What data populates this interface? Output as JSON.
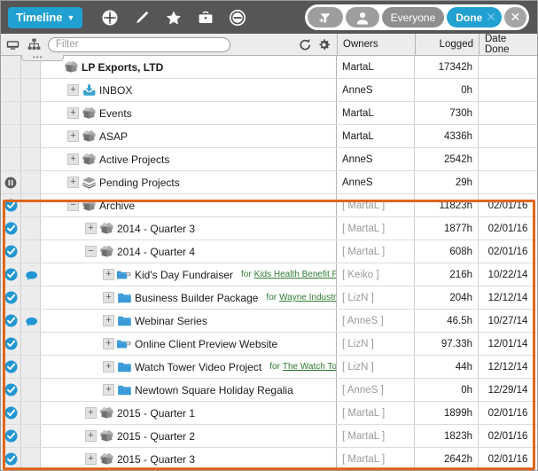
{
  "toolbar": {
    "timeline_label": "Timeline",
    "caret": "▼",
    "icons": [
      {
        "name": "add-icon",
        "label": "Add"
      },
      {
        "name": "edit-pencil-icon",
        "label": "Edit"
      },
      {
        "name": "star-icon",
        "label": "Favorite"
      },
      {
        "name": "briefcase-icon",
        "label": "Briefcase"
      },
      {
        "name": "minus-circle-icon",
        "label": "Remove"
      }
    ],
    "pills": {
      "filter_icon": "filter-add-icon",
      "person_icon": "person-icon",
      "everyone_label": "Everyone",
      "done_label": "Done",
      "done_close": "✕",
      "close_label": "✕"
    }
  },
  "filterbar": {
    "view_icon": "monitor-icon",
    "hierarchy_icon": "org-tree-icon",
    "placeholder": "Filter",
    "value": "",
    "refresh_icon": "refresh-icon",
    "settings_icon": "gear-icon",
    "columns": {
      "owners": "Owners",
      "logged": "Logged",
      "date_done": "Date Done"
    }
  },
  "tree": {
    "rows": [
      {
        "indent": 0,
        "twisty": "",
        "icon": "box-icon",
        "label": "LP Exports, LTD",
        "bold": true,
        "owner": "MartaL",
        "logged": "17342h",
        "date": "",
        "check": false,
        "comment": false,
        "dim": false,
        "pause": false,
        "for_label": "",
        "for_link": ""
      },
      {
        "indent": 1,
        "twisty": "+",
        "icon": "inbox-icon",
        "label": "INBOX",
        "bold": false,
        "owner": "AnneS",
        "logged": "0h",
        "date": "",
        "check": false,
        "comment": false,
        "dim": false,
        "pause": false,
        "for_label": "",
        "for_link": ""
      },
      {
        "indent": 1,
        "twisty": "+",
        "icon": "box-icon",
        "label": "Events",
        "bold": false,
        "owner": "MartaL",
        "logged": "730h",
        "date": "",
        "check": false,
        "comment": false,
        "dim": false,
        "pause": false,
        "for_label": "",
        "for_link": ""
      },
      {
        "indent": 1,
        "twisty": "+",
        "icon": "box-icon",
        "label": "ASAP",
        "bold": false,
        "owner": "MartaL",
        "logged": "4336h",
        "date": "",
        "check": false,
        "comment": false,
        "dim": false,
        "pause": false,
        "for_label": "",
        "for_link": ""
      },
      {
        "indent": 1,
        "twisty": "+",
        "icon": "box-icon",
        "label": "Active Projects",
        "bold": false,
        "owner": "AnneS",
        "logged": "2542h",
        "date": "",
        "check": false,
        "comment": false,
        "dim": false,
        "pause": false,
        "for_label": "",
        "for_link": ""
      },
      {
        "indent": 1,
        "twisty": "+",
        "icon": "stack-icon",
        "label": "Pending Projects",
        "bold": false,
        "owner": "AnneS",
        "logged": "29h",
        "date": "",
        "check": false,
        "comment": false,
        "dim": false,
        "pause": true,
        "for_label": "",
        "for_link": ""
      },
      {
        "indent": 1,
        "twisty": "−",
        "icon": "box-icon",
        "label": "Archive",
        "bold": false,
        "owner": "[ MartaL ]",
        "logged": "11823h",
        "date": "02/01/16",
        "check": true,
        "comment": false,
        "dim": true,
        "pause": false,
        "for_label": "",
        "for_link": ""
      },
      {
        "indent": 2,
        "twisty": "+",
        "icon": "box-icon",
        "label": "2014 - Quarter 3",
        "bold": false,
        "owner": "[ MartaL ]",
        "logged": "1877h",
        "date": "02/01/16",
        "check": true,
        "comment": false,
        "dim": true,
        "pause": false,
        "for_label": "",
        "for_link": ""
      },
      {
        "indent": 2,
        "twisty": "−",
        "icon": "box-icon",
        "label": "2014 - Quarter 4",
        "bold": false,
        "owner": "[ MartaL ]",
        "logged": "608h",
        "date": "02/01/16",
        "check": true,
        "comment": false,
        "dim": true,
        "pause": false,
        "for_label": "",
        "for_link": ""
      },
      {
        "indent": 3,
        "twisty": "+",
        "icon": "folder-arrow-icon",
        "label": "Kid's Day Fundraiser",
        "bold": false,
        "owner": "[ Keiko ]",
        "logged": "216h",
        "date": "10/22/14",
        "check": true,
        "comment": true,
        "dim": true,
        "pause": false,
        "for_label": "for",
        "for_link": "Kids Health Benefit Fund"
      },
      {
        "indent": 3,
        "twisty": "+",
        "icon": "folder-icon",
        "label": "Business Builder Package",
        "bold": false,
        "owner": "[ LizN ]",
        "logged": "204h",
        "date": "12/12/14",
        "check": true,
        "comment": false,
        "dim": true,
        "pause": false,
        "for_label": "for",
        "for_link": "Wayne Industries"
      },
      {
        "indent": 3,
        "twisty": "+",
        "icon": "folder-icon",
        "label": "Webinar Series",
        "bold": false,
        "owner": "[ AnneS ]",
        "logged": "46.5h",
        "date": "10/27/14",
        "check": true,
        "comment": true,
        "dim": true,
        "pause": false,
        "for_label": "",
        "for_link": ""
      },
      {
        "indent": 3,
        "twisty": "+",
        "icon": "folder-arrow-icon",
        "label": "Online Client Preview Website",
        "bold": false,
        "owner": "[ LizN ]",
        "logged": "97.33h",
        "date": "12/01/14",
        "check": true,
        "comment": false,
        "dim": true,
        "pause": false,
        "for_label": "",
        "for_link": ""
      },
      {
        "indent": 3,
        "twisty": "+",
        "icon": "folder-icon",
        "label": "Watch Tower Video Project",
        "bold": false,
        "owner": "[ LizN ]",
        "logged": "44h",
        "date": "12/12/14",
        "check": true,
        "comment": false,
        "dim": true,
        "pause": false,
        "for_label": "for",
        "for_link": "The Watch Tower"
      },
      {
        "indent": 3,
        "twisty": "+",
        "icon": "folder-icon",
        "label": "Newtown Square Holiday Regalia",
        "bold": false,
        "owner": "[ AnneS ]",
        "logged": "0h",
        "date": "12/29/14",
        "check": true,
        "comment": false,
        "dim": true,
        "pause": false,
        "for_label": "",
        "for_link": ""
      },
      {
        "indent": 2,
        "twisty": "+",
        "icon": "box-icon",
        "label": "2015 - Quarter 1",
        "bold": false,
        "owner": "[ MartaL ]",
        "logged": "1899h",
        "date": "02/01/16",
        "check": true,
        "comment": false,
        "dim": true,
        "pause": false,
        "for_label": "",
        "for_link": ""
      },
      {
        "indent": 2,
        "twisty": "+",
        "icon": "box-icon",
        "label": "2015 - Quarter 2",
        "bold": false,
        "owner": "[ MartaL ]",
        "logged": "1823h",
        "date": "02/01/16",
        "check": true,
        "comment": false,
        "dim": true,
        "pause": false,
        "for_label": "",
        "for_link": ""
      },
      {
        "indent": 2,
        "twisty": "+",
        "icon": "box-icon",
        "label": "2015 - Quarter 3",
        "bold": false,
        "owner": "[ MartaL ]",
        "logged": "2642h",
        "date": "02/01/16",
        "check": true,
        "comment": false,
        "dim": true,
        "pause": false,
        "for_label": "",
        "for_link": ""
      }
    ]
  },
  "colors": {
    "toolbar_bg": "#565656",
    "accent_blue": "#21a0d2",
    "selection_orange": "#e0671a",
    "link_green": "#2f7d32",
    "gutter_gray": "#ececec"
  }
}
